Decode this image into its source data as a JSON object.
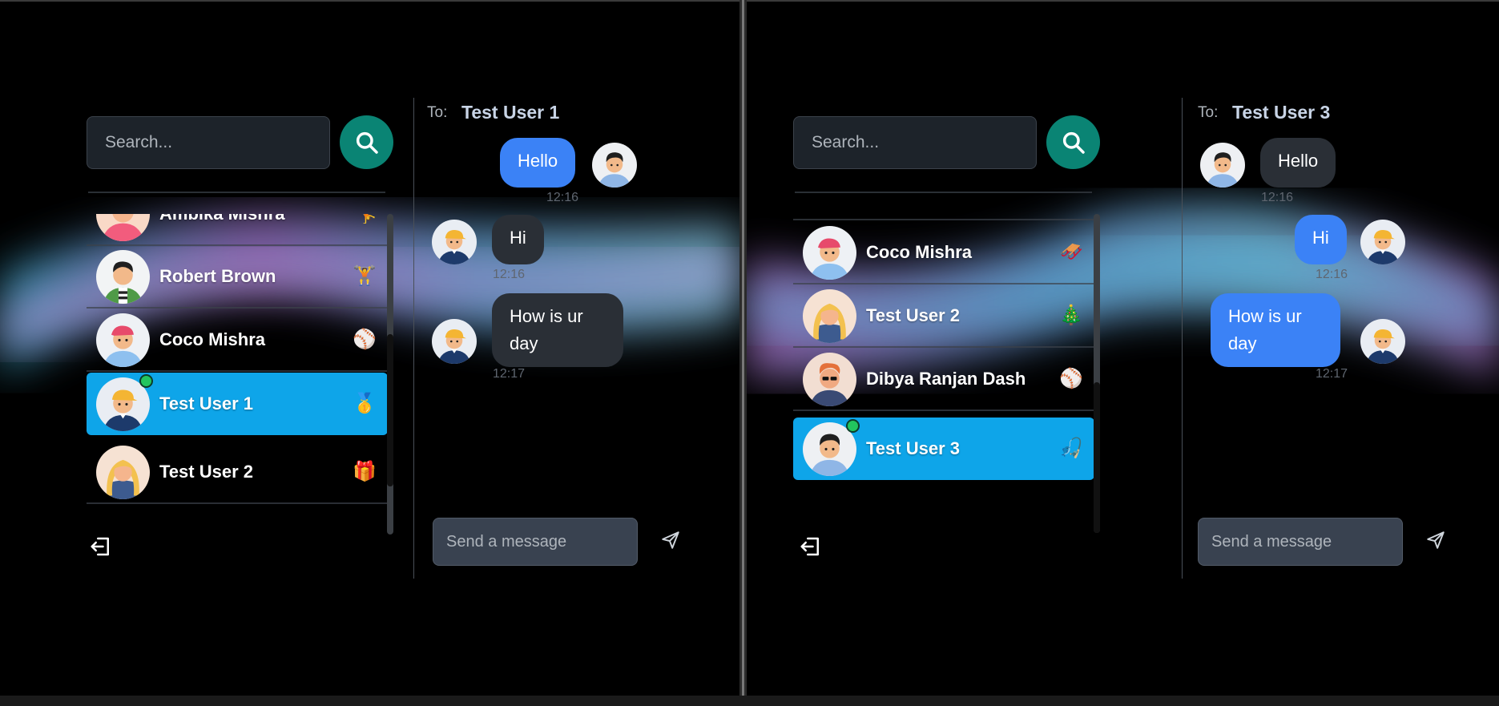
{
  "left": {
    "search": {
      "placeholder": "Search..."
    },
    "contacts": [
      {
        "name": "Ambika Mishra",
        "emoji": "🤸"
      },
      {
        "name": "Robert Brown",
        "emoji": "🏋️"
      },
      {
        "name": "Coco Mishra",
        "emoji": "⚾"
      },
      {
        "name": "Test User 1",
        "emoji": "🥇",
        "active": true,
        "online": true
      },
      {
        "name": "Test User 2",
        "emoji": "🎁"
      }
    ],
    "chat": {
      "to_label": "To:",
      "to_name": "Test User 1",
      "messages": [
        {
          "text": "Hello",
          "time": "12:16",
          "mine": true
        },
        {
          "text": "Hi",
          "time": "12:16",
          "mine": false
        },
        {
          "text": "How is ur day",
          "time": "12:17",
          "mine": false
        }
      ],
      "composer_placeholder": "Send a message"
    }
  },
  "right": {
    "search": {
      "placeholder": "Search..."
    },
    "contacts": [
      {
        "name": "Coco Mishra",
        "emoji": "🛷"
      },
      {
        "name": "Test User 2",
        "emoji": "🎄"
      },
      {
        "name": "Dibya Ranjan Dash",
        "emoji": "⚾"
      },
      {
        "name": "Test User 3",
        "emoji": "🎣",
        "active": true,
        "online": true
      }
    ],
    "chat": {
      "to_label": "To:",
      "to_name": "Test User 3",
      "messages": [
        {
          "text": "Hello",
          "time": "12:16",
          "mine": false
        },
        {
          "text": "Hi",
          "time": "12:16",
          "mine": true
        },
        {
          "text": "How is ur day",
          "time": "12:17",
          "mine": true
        }
      ],
      "composer_placeholder": "Send a message"
    }
  },
  "colors": {
    "accent_active": "#0ea5e9",
    "bubble_blue": "#3b82f6",
    "bubble_gray": "#2a2f36",
    "search_button": "#0a8474",
    "online": "#22c55e"
  },
  "icons": [
    "search-icon",
    "logout-icon",
    "send-icon",
    "avatar-icon"
  ]
}
